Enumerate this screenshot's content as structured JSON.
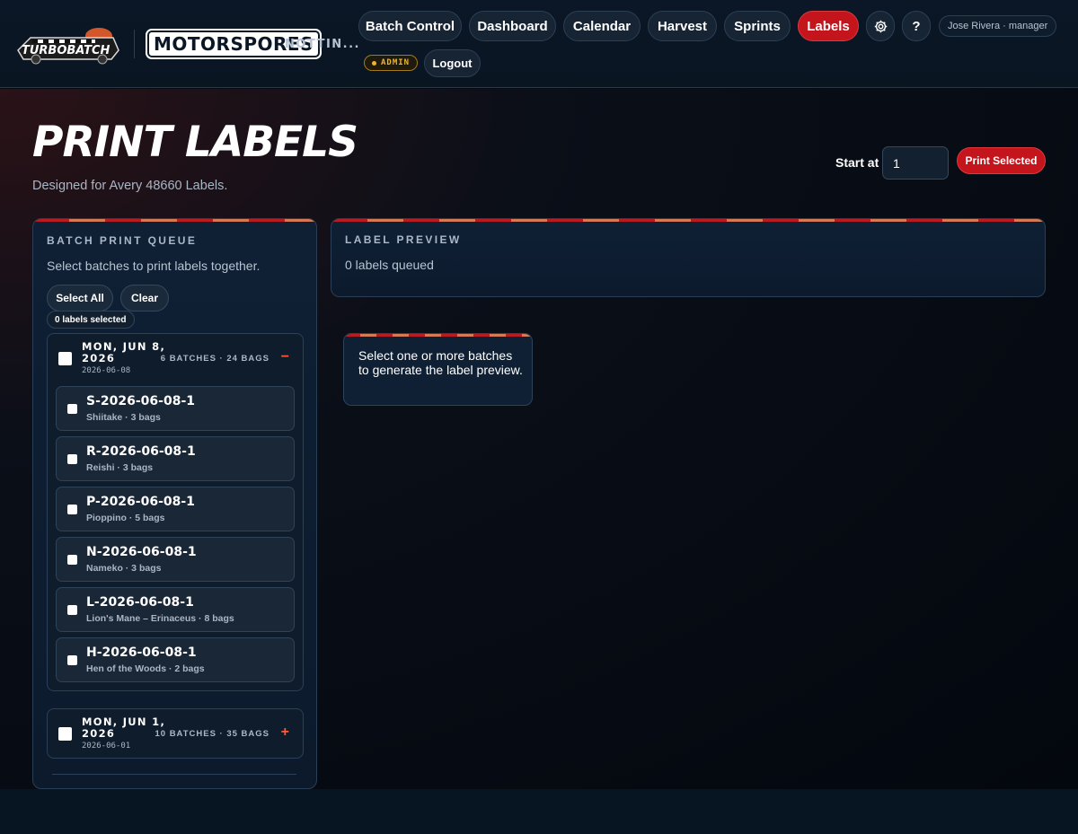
{
  "header": {
    "brand_turbo": "TURBOBATCH",
    "brand_moto": "MOTORSPORES",
    "location": "NOTTIN...",
    "nav": [
      {
        "label": "Batch Control"
      },
      {
        "label": "Dashboard"
      },
      {
        "label": "Calendar"
      },
      {
        "label": "Harvest"
      },
      {
        "label": "Sprints"
      },
      {
        "label": "Labels",
        "active": true
      }
    ],
    "settings_icon": "gear-icon",
    "help_label": "?",
    "user": "Jose Rivera · manager",
    "admin_badge": "ADMIN",
    "logout_label": "Logout"
  },
  "page": {
    "title": "PRINT LABELS",
    "subtitle": "Designed for Avery 48660 Labels.",
    "start_at_label": "Start at",
    "start_at_value": "1",
    "print_selected_label": "Print Selected"
  },
  "queue": {
    "title": "BATCH PRINT QUEUE",
    "description": "Select batches to print labels together.",
    "select_all_label": "Select All",
    "clear_label": "Clear",
    "selected_count": "0 labels selected",
    "groups": [
      {
        "date": "MON, JUN 8, 2026",
        "iso": "2026-06-08",
        "meta": "6 BATCHES · 24 BAGS",
        "toggle": "−",
        "expanded": true,
        "batches": [
          {
            "code": "S-2026-06-08-1",
            "desc": "Shiitake · 3 bags"
          },
          {
            "code": "R-2026-06-08-1",
            "desc": "Reishi · 3 bags"
          },
          {
            "code": "P-2026-06-08-1",
            "desc": "Pioppino · 5 bags"
          },
          {
            "code": "N-2026-06-08-1",
            "desc": "Nameko · 3 bags"
          },
          {
            "code": "L-2026-06-08-1",
            "desc": "Lion's Mane – Erinaceus · 8 bags"
          },
          {
            "code": "H-2026-06-08-1",
            "desc": "Hen of the Woods · 2 bags"
          }
        ]
      },
      {
        "date": "MON, JUN 1, 2026",
        "iso": "2026-06-01",
        "meta": "10 BATCHES · 35 BAGS",
        "toggle": "+",
        "expanded": false,
        "batches": []
      }
    ]
  },
  "preview": {
    "title": "LABEL PREVIEW",
    "count": "0 labels queued",
    "hint": "Select one or more batches to generate the label preview."
  },
  "colors": {
    "accent_red": "#c4151c",
    "admin_gold": "#f0b429",
    "toggle_orange": "#ff5a36",
    "panel_bg": "#0f2035"
  }
}
